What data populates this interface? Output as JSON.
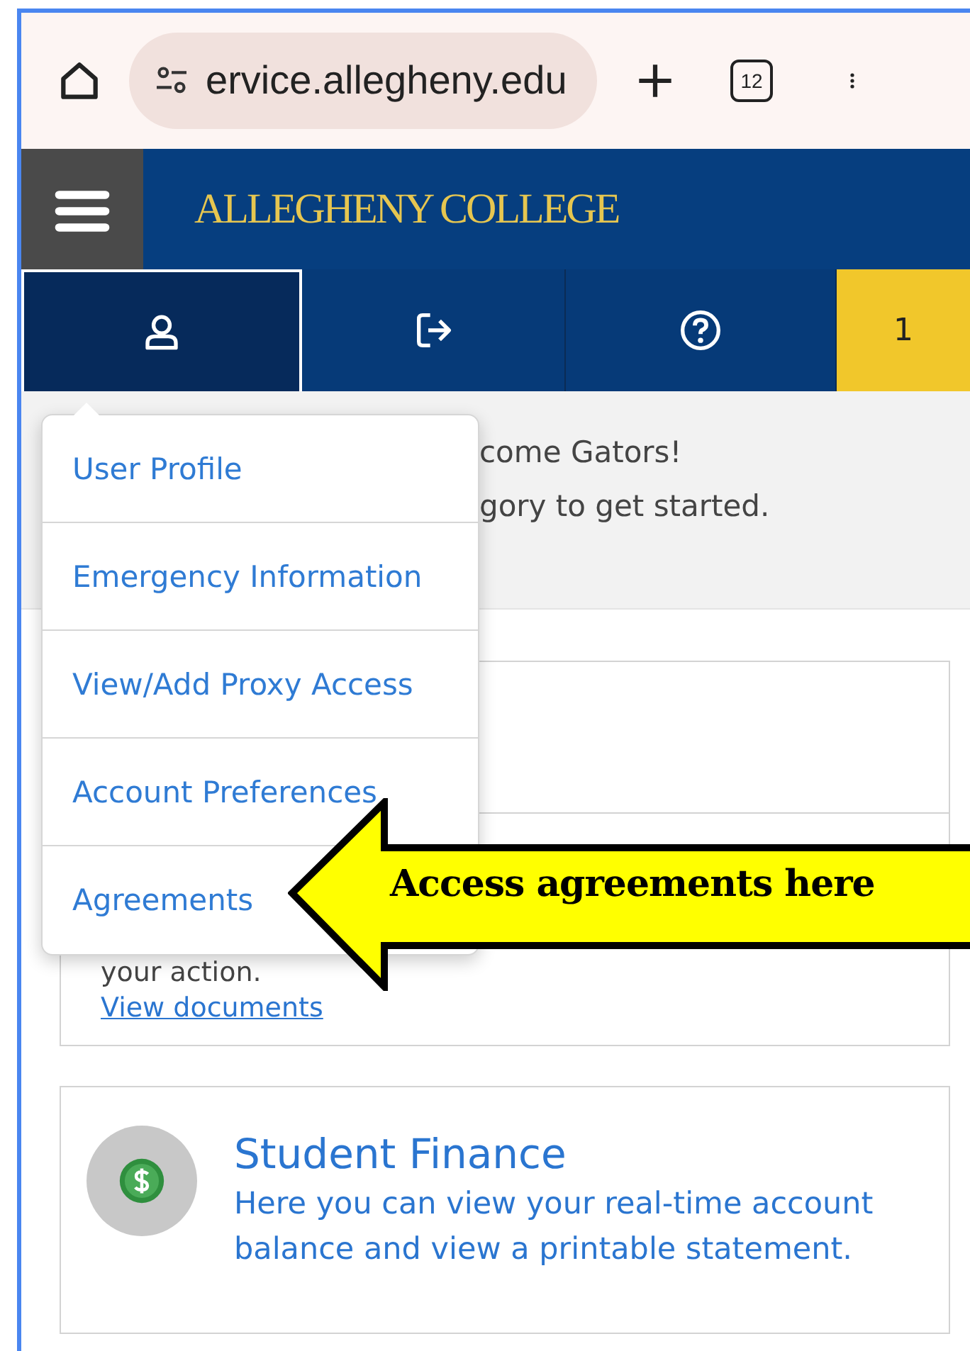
{
  "browser": {
    "url": "ervice.allegheny.edu",
    "tab_count": "12"
  },
  "header": {
    "logo": "ALLEGHENY COLLEGE"
  },
  "tabs": [
    {
      "kind": "user",
      "selected": true
    },
    {
      "kind": "logout",
      "selected": false
    },
    {
      "kind": "help",
      "selected": false
    },
    {
      "kind": "count",
      "label": "1",
      "selected": false
    }
  ],
  "welcome": [
    "come Gators!",
    "gory to get started."
  ],
  "dropdown": [
    "User Profile",
    "Emergency Information",
    "View/Add Proxy Access",
    "Account Preferences",
    "Agreements"
  ],
  "cards": [
    {
      "kind": "documents",
      "text": "your action.",
      "link": "View documents"
    },
    {
      "kind": "finance",
      "title": "Student Finance",
      "description": "Here you can view your real-time account balance and view a printable statement."
    }
  ],
  "callout": {
    "text": "Access agreements here"
  }
}
